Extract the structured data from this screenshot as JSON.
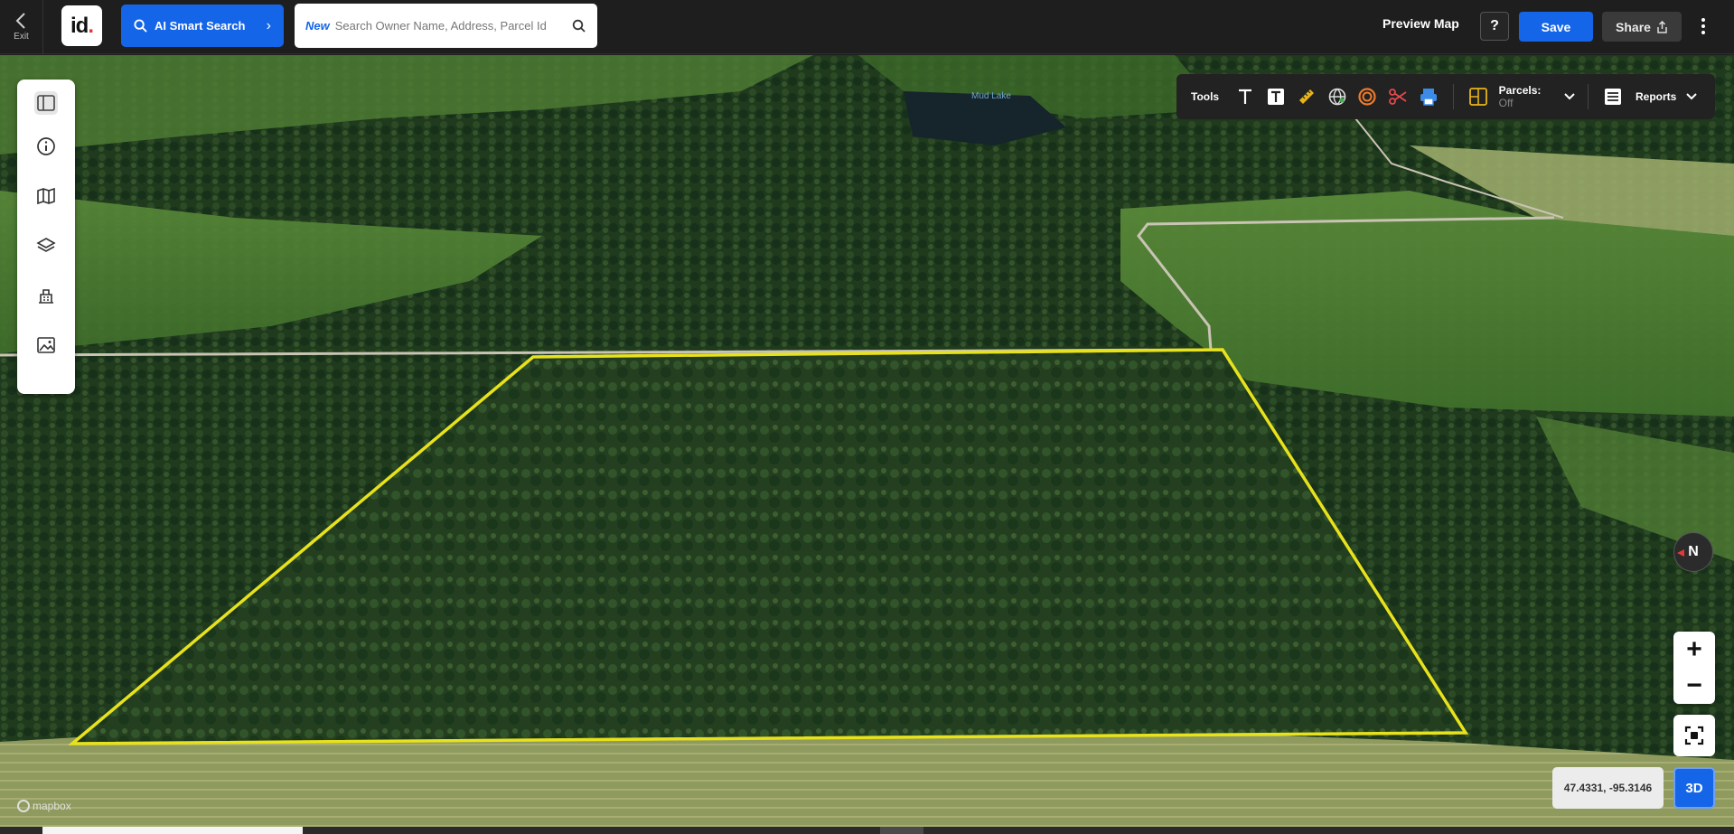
{
  "header": {
    "exit_label": "Exit",
    "logo_text": "id",
    "ai_search_label": "AI Smart Search",
    "search_new_tag": "New",
    "search_placeholder": "Search Owner Name, Address, Parcel Id",
    "preview_map_label": "Preview Map",
    "help_label": "?",
    "save_label": "Save",
    "share_label": "Share"
  },
  "left_panel": {
    "icons": [
      "sidebar-toggle-icon",
      "info-icon",
      "map-icon",
      "layers-icon",
      "buildings-icon",
      "image-icon"
    ]
  },
  "tools": {
    "label": "Tools",
    "icons": [
      "text-icon",
      "text-box-icon",
      "ruler-icon",
      "globe-icon",
      "radius-icon",
      "scissors-icon",
      "print-icon"
    ],
    "parcels_label": "Parcels:",
    "parcels_state": "Off",
    "reports_label": "Reports"
  },
  "map": {
    "lake_label": "Mud Lake",
    "compass_label": "N",
    "coordinates": "47.4331, -95.3146",
    "three_d_label": "3D",
    "attribution": "mapbox",
    "boundary_color": "#e8e21c"
  },
  "colors": {
    "accent": "#1565e8",
    "topbar": "#1e1e1e"
  }
}
